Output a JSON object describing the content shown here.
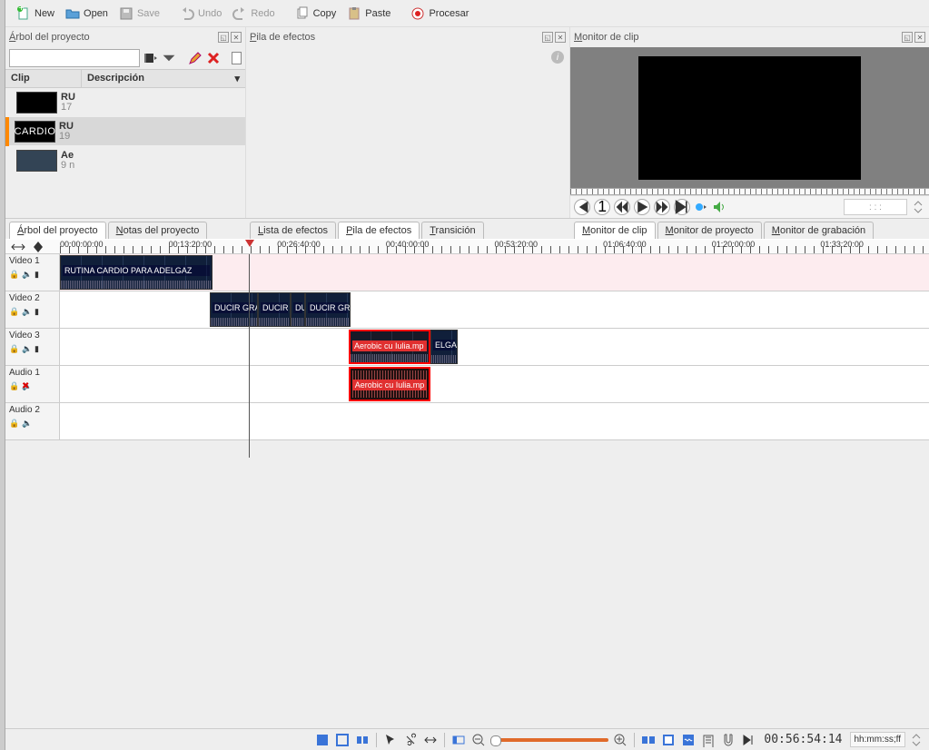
{
  "toolbar": {
    "new": "New",
    "open": "Open",
    "save": "Save",
    "undo": "Undo",
    "redo": "Redo",
    "copy": "Copy",
    "paste": "Paste",
    "render": "Procesar"
  },
  "panel_project": {
    "title_pre": "Á",
    "title_rest": "rbol del proyecto",
    "col_clip": "Clip",
    "col_desc": "Descripción",
    "items": [
      {
        "name": "RU",
        "detail": "17"
      },
      {
        "name": "RU",
        "detail": "19"
      },
      {
        "name": "Ae",
        "detail": "9 n"
      }
    ],
    "thumb_text_cardio": "CARDIO"
  },
  "panel_effects": {
    "title_pre": "P",
    "title_rest": "ila de efectos"
  },
  "panel_monitor": {
    "title_pre": "M",
    "title_rest": "onitor de clip",
    "time_placeholder": ": : :"
  },
  "tabs_left": {
    "project_pre": "Á",
    "project_rest": "rbol del proyecto",
    "notes_pre": "N",
    "notes_rest": "otas del proyecto"
  },
  "tabs_mid": {
    "list_pre": "L",
    "list_rest": "ista de efectos",
    "stack_pre": "P",
    "stack_rest": "ila de efectos",
    "trans_pre": "T",
    "trans_rest": "ransición"
  },
  "tabs_right": {
    "clip_pre": "M",
    "clip_rest": "onitor de clip",
    "proj_pre": "M",
    "proj_rest": "onitor de proyecto",
    "rec_pre": "M",
    "rec_rest": "onitor de grabación"
  },
  "timeline": {
    "ruler": [
      "00:00:00:00",
      "00:13:20:00",
      "00:26:40:00",
      "00:40:00:00",
      "00:53:20:00",
      "01:06:40:00",
      "01:20:00:00",
      "01:33:20:00"
    ],
    "tracks": {
      "v1": "Video 1",
      "v2": "Video 2",
      "v3": "Video 3",
      "a1": "Audio 1",
      "a2": "Audio 2"
    },
    "clips": {
      "v1": "RUTINA CARDIO PARA ADELGAZ",
      "v2a": "DUCIR GRA",
      "v2b": "DUCIR",
      "v2c": "DU",
      "v2d": "DUCIR GR",
      "v3a": "Aerobic cu Iulia.mp",
      "v3b": "ELGAZ",
      "a1": "Aerobic cu Iulia.mp"
    }
  },
  "bottom": {
    "timecode": "00:56:54:14",
    "format": "hh:mm:ss;ff"
  }
}
